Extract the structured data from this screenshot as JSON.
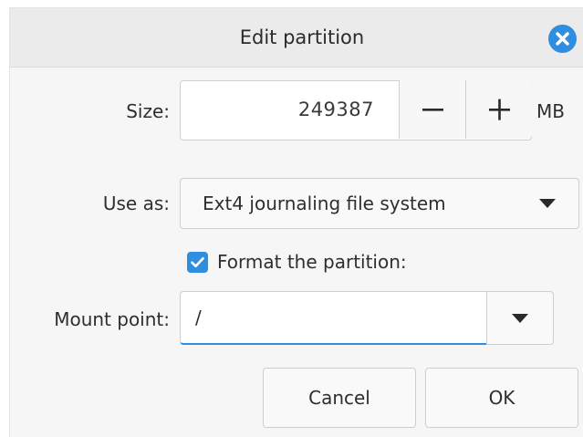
{
  "dialog": {
    "title": "Edit partition",
    "close_icon": "close-icon"
  },
  "size": {
    "label": "Size:",
    "value": "249387",
    "unit": "MB",
    "decrement_label": "−",
    "increment_label": "+"
  },
  "use_as": {
    "label": "Use as:",
    "selected": "Ext4 journaling file system"
  },
  "format": {
    "label": "Format the partition:",
    "checked": true
  },
  "mount_point": {
    "label": "Mount point:",
    "value": "/"
  },
  "buttons": {
    "cancel": "Cancel",
    "ok": "OK"
  },
  "colors": {
    "accent": "#2f8ee0",
    "dialog_bg": "#f6f6f6",
    "titlebar_bg": "#ebebeb"
  }
}
